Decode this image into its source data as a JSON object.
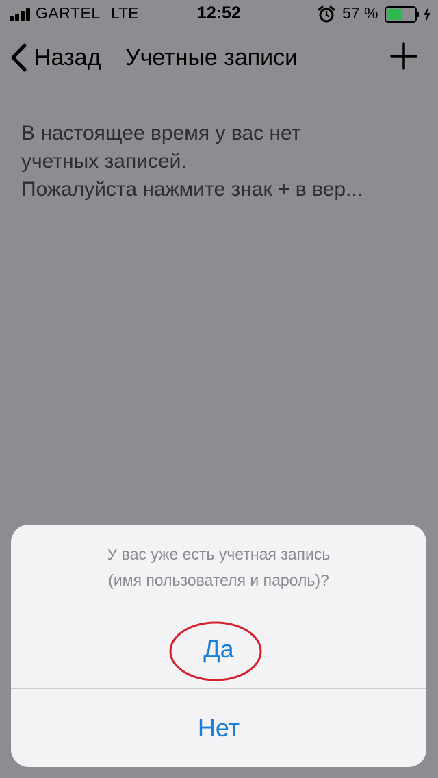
{
  "status_bar": {
    "carrier": "GARTEL",
    "network": "LTE",
    "time": "12:52",
    "battery_percent": "57 %",
    "battery_level": 0.57,
    "battery_color": "#2fb84f"
  },
  "nav": {
    "back_label": "Назад",
    "title": "Учетные записи",
    "icons": {
      "back": "chevron-left-icon",
      "add": "plus-icon"
    }
  },
  "empty_state": {
    "lines": [
      "В настоящее время у вас нет",
      "учетных записей.",
      "Пожалуйста нажмите знак + в вер..."
    ]
  },
  "action_sheet": {
    "message_lines": [
      "У вас уже есть учетная запись",
      "(имя пользователя и пароль)?"
    ],
    "buttons": {
      "yes": "Да",
      "no": "Нет"
    },
    "accent_color": "#1b7fd8",
    "annotation_color": "#d4202a"
  }
}
